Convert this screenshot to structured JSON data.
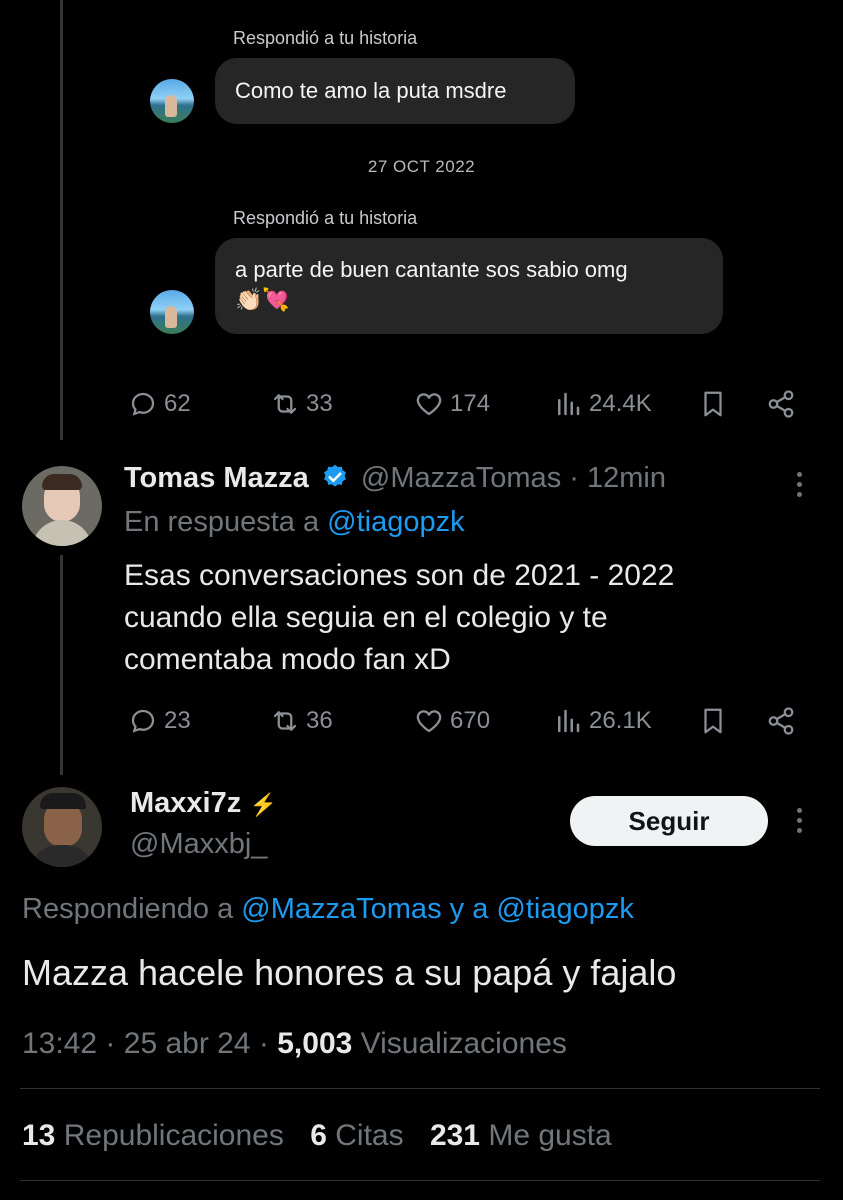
{
  "dm_thread": {
    "messages": [
      {
        "reply_label": "Respondió a tu historia",
        "text": "Como te amo la puta msdre"
      },
      {
        "reply_label": "Respondió a tu historia",
        "text": "a parte de buen cantante sos sabio omg",
        "emoji": "👏🏻💘"
      }
    ],
    "date_separator": "27 OCT 2022"
  },
  "tweet1_actions": {
    "replies": "62",
    "retweets": "33",
    "likes": "174",
    "views": "24.4K"
  },
  "tweet2": {
    "author_name": "Tomas Mazza",
    "handle": "@MazzaTomas",
    "time": "· 12min",
    "reply_prefix": "En respuesta a",
    "reply_to": "@tiagopzk",
    "text_line1": "Esas conversaciones son de 2021 - 2022",
    "text_line2": "cuando ella seguia en el colegio y te",
    "text_line3": "comentaba modo fan xD",
    "actions": {
      "replies": "23",
      "retweets": "36",
      "likes": "670",
      "views": "26.1K"
    }
  },
  "tweet3": {
    "author_name": "Maxxi7z",
    "name_suffix_emoji": "⚡",
    "handle": "@Maxxbj_",
    "follow_label": "Seguir",
    "replying_prefix": "Respondiendo a",
    "replying_to_1": "@MazzaTomas",
    "replying_connector": "y a",
    "replying_to_2": "@tiagopzk",
    "text": "Mazza hacele honores a su papá y fajalo",
    "time": "13:42",
    "date": "25 abr 24",
    "views_count": "5,003",
    "views_label": "Visualizaciones",
    "stats": {
      "reposts_count": "13",
      "reposts_label": "Republicaciones",
      "quotes_count": "6",
      "quotes_label": "Citas",
      "likes_count": "231",
      "likes_label": "Me gusta"
    }
  },
  "colors": {
    "background": "#000000",
    "link": "#1d9bf0",
    "muted": "#71767b",
    "verified": "#1d9bf0",
    "bubble": "#262626"
  }
}
